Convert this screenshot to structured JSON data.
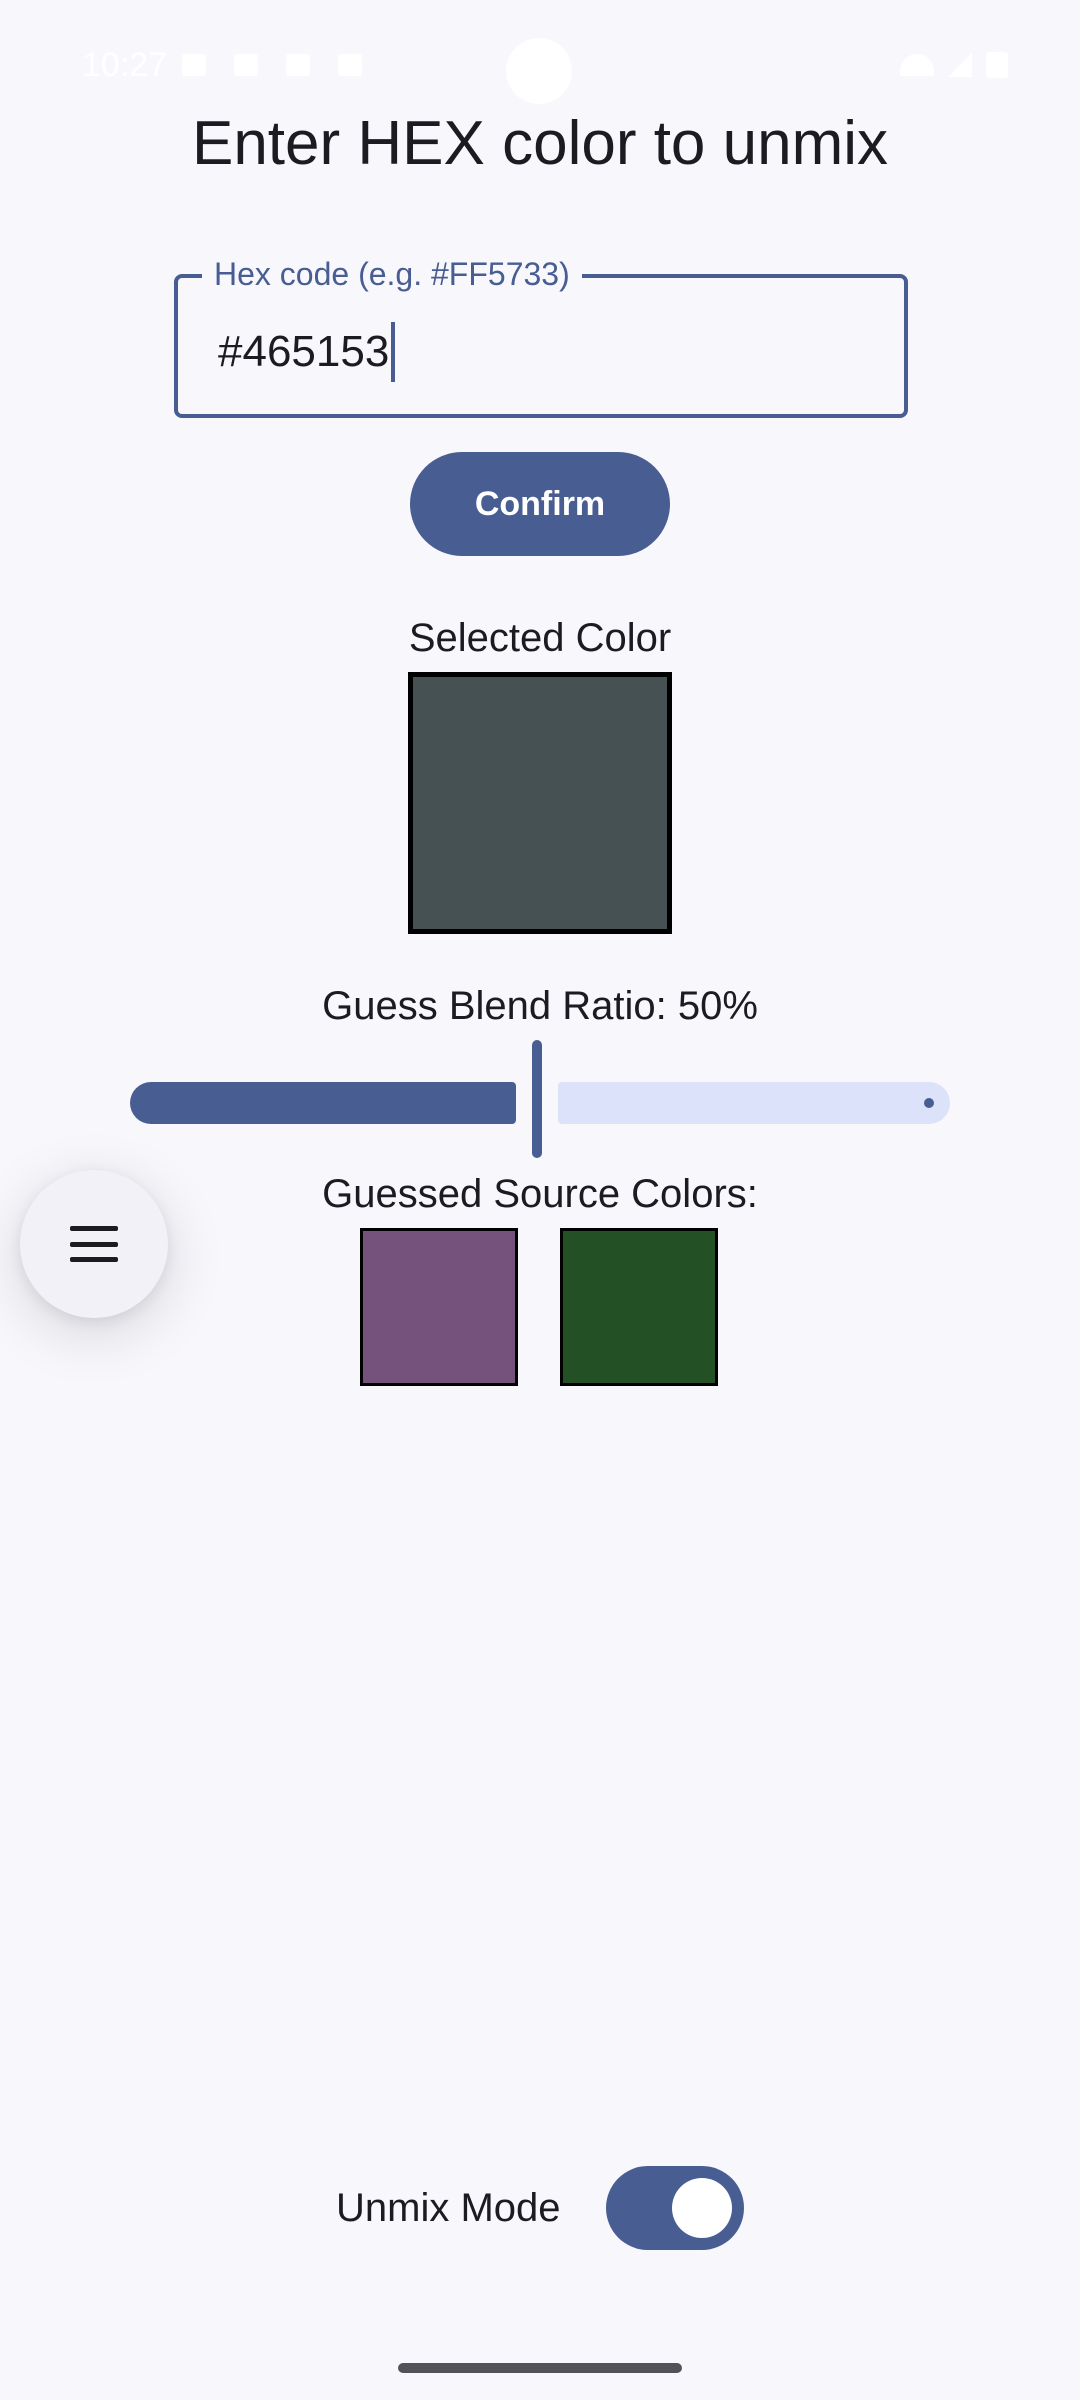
{
  "status_bar": {
    "time": "10:27",
    "left_icons": [
      "screenshot-icon",
      "notification-icon",
      "camera-icon",
      "cloud-icon"
    ],
    "right_icons": [
      "wifi-icon",
      "signal-icon",
      "battery-icon"
    ]
  },
  "title": "Enter HEX color to unmix",
  "hex_input": {
    "label": "Hex code (e.g. #FF5733)",
    "value": "#465153"
  },
  "confirm_button": {
    "label": "Confirm"
  },
  "selected_color": {
    "label": "Selected Color",
    "color": "#465153"
  },
  "blend_ratio": {
    "label": "Guess Blend Ratio: 50%",
    "value": 0.5
  },
  "guessed_sources": {
    "label": "Guessed Source Colors:",
    "colors": [
      "#74527c",
      "#245026"
    ]
  },
  "menu_button": {
    "icon": "hamburger-menu-icon"
  },
  "unmix_mode": {
    "label": "Unmix Mode",
    "enabled": true
  },
  "colors": {
    "primary": "#485d92",
    "primary_container": "#dce2f9",
    "background": "#f8f7fc"
  }
}
